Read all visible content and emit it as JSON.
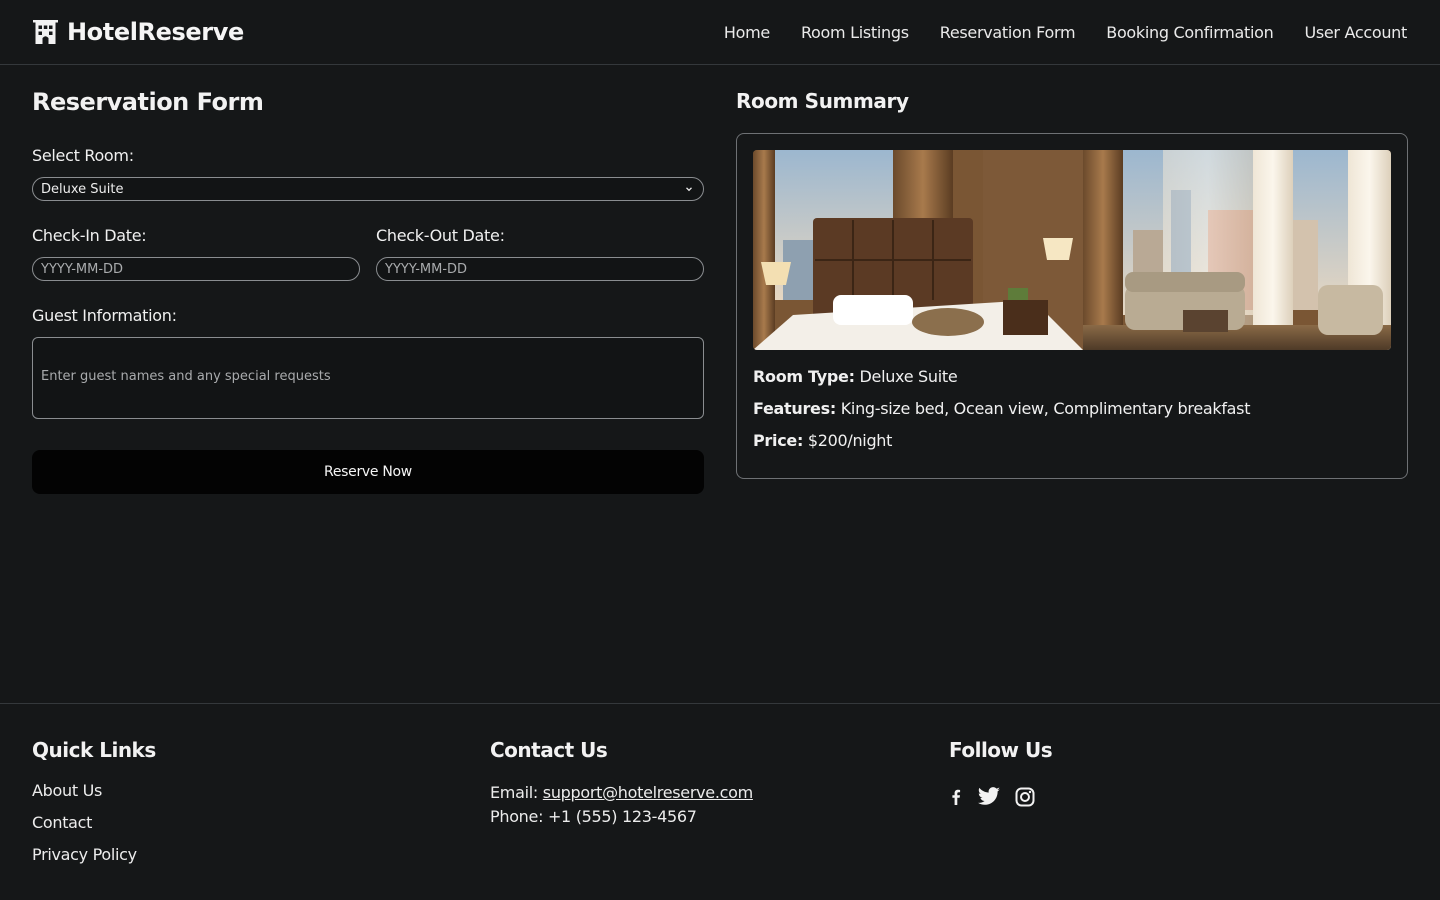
{
  "app": {
    "brand": "HotelReserve",
    "nav": [
      "Home",
      "Room Listings",
      "Reservation Form",
      "Booking Confirmation",
      "User Account"
    ]
  },
  "form": {
    "title": "Reservation Form",
    "room_label": "Select Room:",
    "room_selected": "Deluxe Suite",
    "checkin_label": "Check-In Date:",
    "checkin_placeholder": "YYYY-MM-DD",
    "checkout_label": "Check-Out Date:",
    "checkout_placeholder": "YYYY-MM-DD",
    "guest_label": "Guest Information:",
    "guest_placeholder": "Enter guest names and any special requests",
    "submit_label": "Reserve Now"
  },
  "summary": {
    "title": "Room Summary",
    "type_label": "Room Type:",
    "type_value": "Deluxe Suite",
    "features_label": "Features:",
    "features_value": "King-size bed, Ocean view, Complimentary breakfast",
    "price_label": "Price:",
    "price_value": "$200/night"
  },
  "footer": {
    "quick_links_title": "Quick Links",
    "quick_links": [
      "About Us",
      "Contact",
      "Privacy Policy"
    ],
    "contact_title": "Contact Us",
    "email_label": "Email:",
    "email": "support@hotelreserve.com",
    "phone_label": "Phone:",
    "phone": "+1 (555) 123-4567",
    "follow_title": "Follow Us",
    "socials": [
      "facebook-icon",
      "twitter-icon",
      "instagram-icon"
    ]
  },
  "colors": {
    "background": "#151718",
    "button": "#030303",
    "text": "#f2f2f2",
    "border": "#8a8d90"
  }
}
